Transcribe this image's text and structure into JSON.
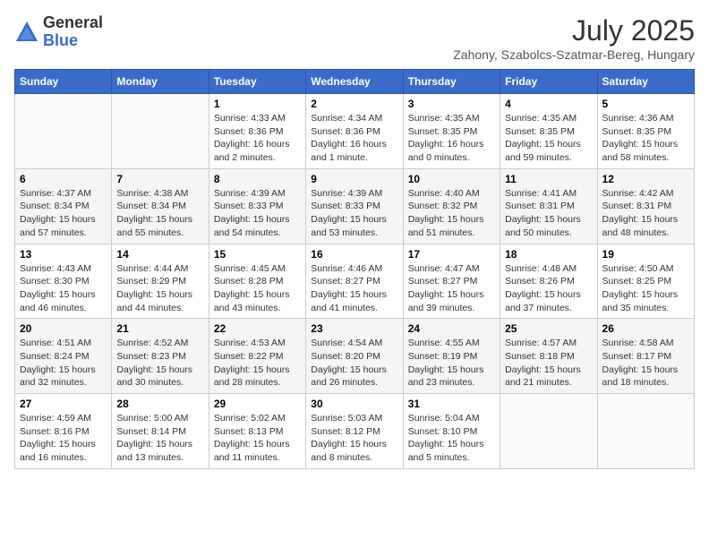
{
  "header": {
    "logo_general": "General",
    "logo_blue": "Blue",
    "month_year": "July 2025",
    "location": "Zahony, Szabolcs-Szatmar-Bereg, Hungary"
  },
  "weekdays": [
    "Sunday",
    "Monday",
    "Tuesday",
    "Wednesday",
    "Thursday",
    "Friday",
    "Saturday"
  ],
  "weeks": [
    [
      {
        "day": "",
        "info": ""
      },
      {
        "day": "",
        "info": ""
      },
      {
        "day": "1",
        "info": "Sunrise: 4:33 AM\nSunset: 8:36 PM\nDaylight: 16 hours\nand 2 minutes."
      },
      {
        "day": "2",
        "info": "Sunrise: 4:34 AM\nSunset: 8:36 PM\nDaylight: 16 hours\nand 1 minute."
      },
      {
        "day": "3",
        "info": "Sunrise: 4:35 AM\nSunset: 8:35 PM\nDaylight: 16 hours\nand 0 minutes."
      },
      {
        "day": "4",
        "info": "Sunrise: 4:35 AM\nSunset: 8:35 PM\nDaylight: 15 hours\nand 59 minutes."
      },
      {
        "day": "5",
        "info": "Sunrise: 4:36 AM\nSunset: 8:35 PM\nDaylight: 15 hours\nand 58 minutes."
      }
    ],
    [
      {
        "day": "6",
        "info": "Sunrise: 4:37 AM\nSunset: 8:34 PM\nDaylight: 15 hours\nand 57 minutes."
      },
      {
        "day": "7",
        "info": "Sunrise: 4:38 AM\nSunset: 8:34 PM\nDaylight: 15 hours\nand 55 minutes."
      },
      {
        "day": "8",
        "info": "Sunrise: 4:39 AM\nSunset: 8:33 PM\nDaylight: 15 hours\nand 54 minutes."
      },
      {
        "day": "9",
        "info": "Sunrise: 4:39 AM\nSunset: 8:33 PM\nDaylight: 15 hours\nand 53 minutes."
      },
      {
        "day": "10",
        "info": "Sunrise: 4:40 AM\nSunset: 8:32 PM\nDaylight: 15 hours\nand 51 minutes."
      },
      {
        "day": "11",
        "info": "Sunrise: 4:41 AM\nSunset: 8:31 PM\nDaylight: 15 hours\nand 50 minutes."
      },
      {
        "day": "12",
        "info": "Sunrise: 4:42 AM\nSunset: 8:31 PM\nDaylight: 15 hours\nand 48 minutes."
      }
    ],
    [
      {
        "day": "13",
        "info": "Sunrise: 4:43 AM\nSunset: 8:30 PM\nDaylight: 15 hours\nand 46 minutes."
      },
      {
        "day": "14",
        "info": "Sunrise: 4:44 AM\nSunset: 8:29 PM\nDaylight: 15 hours\nand 44 minutes."
      },
      {
        "day": "15",
        "info": "Sunrise: 4:45 AM\nSunset: 8:28 PM\nDaylight: 15 hours\nand 43 minutes."
      },
      {
        "day": "16",
        "info": "Sunrise: 4:46 AM\nSunset: 8:27 PM\nDaylight: 15 hours\nand 41 minutes."
      },
      {
        "day": "17",
        "info": "Sunrise: 4:47 AM\nSunset: 8:27 PM\nDaylight: 15 hours\nand 39 minutes."
      },
      {
        "day": "18",
        "info": "Sunrise: 4:48 AM\nSunset: 8:26 PM\nDaylight: 15 hours\nand 37 minutes."
      },
      {
        "day": "19",
        "info": "Sunrise: 4:50 AM\nSunset: 8:25 PM\nDaylight: 15 hours\nand 35 minutes."
      }
    ],
    [
      {
        "day": "20",
        "info": "Sunrise: 4:51 AM\nSunset: 8:24 PM\nDaylight: 15 hours\nand 32 minutes."
      },
      {
        "day": "21",
        "info": "Sunrise: 4:52 AM\nSunset: 8:23 PM\nDaylight: 15 hours\nand 30 minutes."
      },
      {
        "day": "22",
        "info": "Sunrise: 4:53 AM\nSunset: 8:22 PM\nDaylight: 15 hours\nand 28 minutes."
      },
      {
        "day": "23",
        "info": "Sunrise: 4:54 AM\nSunset: 8:20 PM\nDaylight: 15 hours\nand 26 minutes."
      },
      {
        "day": "24",
        "info": "Sunrise: 4:55 AM\nSunset: 8:19 PM\nDaylight: 15 hours\nand 23 minutes."
      },
      {
        "day": "25",
        "info": "Sunrise: 4:57 AM\nSunset: 8:18 PM\nDaylight: 15 hours\nand 21 minutes."
      },
      {
        "day": "26",
        "info": "Sunrise: 4:58 AM\nSunset: 8:17 PM\nDaylight: 15 hours\nand 18 minutes."
      }
    ],
    [
      {
        "day": "27",
        "info": "Sunrise: 4:59 AM\nSunset: 8:16 PM\nDaylight: 15 hours\nand 16 minutes."
      },
      {
        "day": "28",
        "info": "Sunrise: 5:00 AM\nSunset: 8:14 PM\nDaylight: 15 hours\nand 13 minutes."
      },
      {
        "day": "29",
        "info": "Sunrise: 5:02 AM\nSunset: 8:13 PM\nDaylight: 15 hours\nand 11 minutes."
      },
      {
        "day": "30",
        "info": "Sunrise: 5:03 AM\nSunset: 8:12 PM\nDaylight: 15 hours\nand 8 minutes."
      },
      {
        "day": "31",
        "info": "Sunrise: 5:04 AM\nSunset: 8:10 PM\nDaylight: 15 hours\nand 5 minutes."
      },
      {
        "day": "",
        "info": ""
      },
      {
        "day": "",
        "info": ""
      }
    ]
  ]
}
